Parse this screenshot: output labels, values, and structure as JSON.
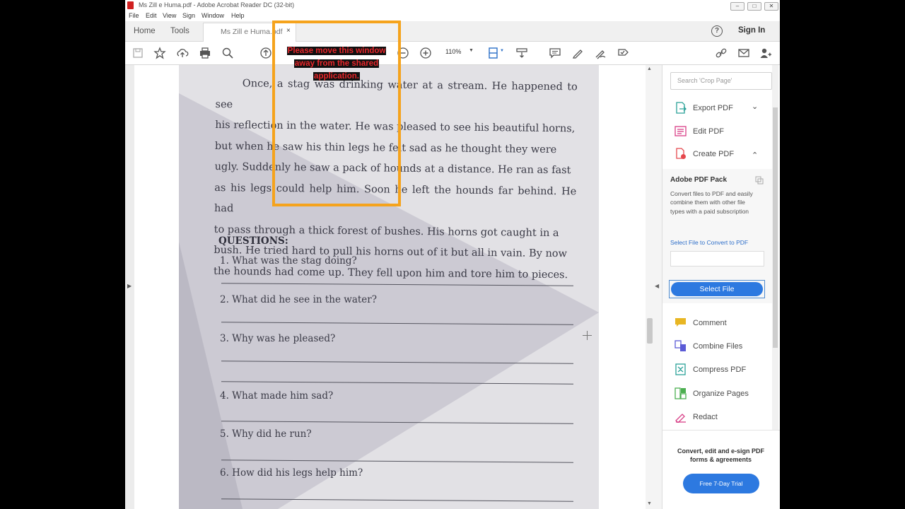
{
  "window": {
    "title": "Ms Zill e Huma.pdf - Adobe Acrobat Reader DC (32-bit)",
    "controls": [
      "–",
      "□",
      "✕"
    ]
  },
  "menu": [
    "File",
    "Edit",
    "View",
    "Sign",
    "Window",
    "Help"
  ],
  "tabs": {
    "home": "Home",
    "tools": "Tools",
    "document": "Ms Zill e Huma.pdf",
    "close": "×"
  },
  "header": {
    "help": "?",
    "signin": "Sign In"
  },
  "toolbar": {
    "zoom": "110%",
    "icons": [
      "save-icon",
      "bookmark-star-icon",
      "upload-cloud-icon",
      "print-icon",
      "zoom-search-icon",
      "page-up-icon",
      "zoom-out-icon",
      "zoom-in-icon",
      "fit-page-icon",
      "scroll-icon",
      "comment-icon",
      "highlight-pen-icon",
      "sign-icon",
      "stamp-icon",
      "link-icon",
      "mail-icon",
      "add-user-icon"
    ]
  },
  "document": {
    "story": [
      "Once, a stag was drinking water at a stream. He happened to see",
      "his reflection in the water. He was pleased to see his beautiful horns,",
      "but when he saw his thin legs he felt sad as he thought they were",
      "ugly. Suddenly he saw a pack of hounds at a distance. He ran as fast",
      "as his legs could help him. Soon he left the hounds far behind. He had",
      "to pass through a thick forest of bushes. His horns got caught in a",
      "bush. He tried hard to pull his horns out of it but all in vain. By now",
      "the hounds had come up. They fell upon him and tore him to pieces."
    ],
    "questions_heading": "QUESTIONS:",
    "questions": [
      "1. What was the stag doing?",
      "2. What did he see in the water?",
      "3. Why was he pleased?",
      "4. What made him sad?",
      "5. Why did he run?",
      "6. How did his legs help him?"
    ]
  },
  "pane": {
    "search_placeholder": "Search 'Crop Page'",
    "items_top": [
      {
        "label": "Export PDF",
        "icon": "export-pdf-icon",
        "color": "#2aa198"
      },
      {
        "label": "Edit PDF",
        "icon": "edit-pdf-icon",
        "color": "#d83f87"
      },
      {
        "label": "Create PDF",
        "icon": "create-pdf-icon",
        "color": "#e5484d"
      }
    ],
    "pack": {
      "title": "Adobe PDF Pack",
      "description": "Convert files to PDF and easily combine them with other file types with a paid subscription",
      "select_link": "Select File to Convert to PDF",
      "button": "Select File"
    },
    "items_bottom": [
      {
        "label": "Comment",
        "icon": "comment-icon",
        "color": "#e8b623"
      },
      {
        "label": "Combine Files",
        "icon": "combine-files-icon",
        "color": "#5b5bd6"
      },
      {
        "label": "Compress PDF",
        "icon": "compress-pdf-icon",
        "color": "#2aa198"
      },
      {
        "label": "Organize Pages",
        "icon": "organize-pages-icon",
        "color": "#4caf50"
      },
      {
        "label": "Redact",
        "icon": "redact-icon",
        "color": "#d83f87"
      }
    ],
    "promo": {
      "text": "Convert, edit and e-sign PDF forms & agreements",
      "button": "Free 7-Day Trial"
    }
  },
  "overlay": {
    "lines": [
      "Please move this window",
      "away from the shared",
      "application."
    ],
    "border_color": "#f5a31c",
    "text_color": "#e8262a"
  }
}
